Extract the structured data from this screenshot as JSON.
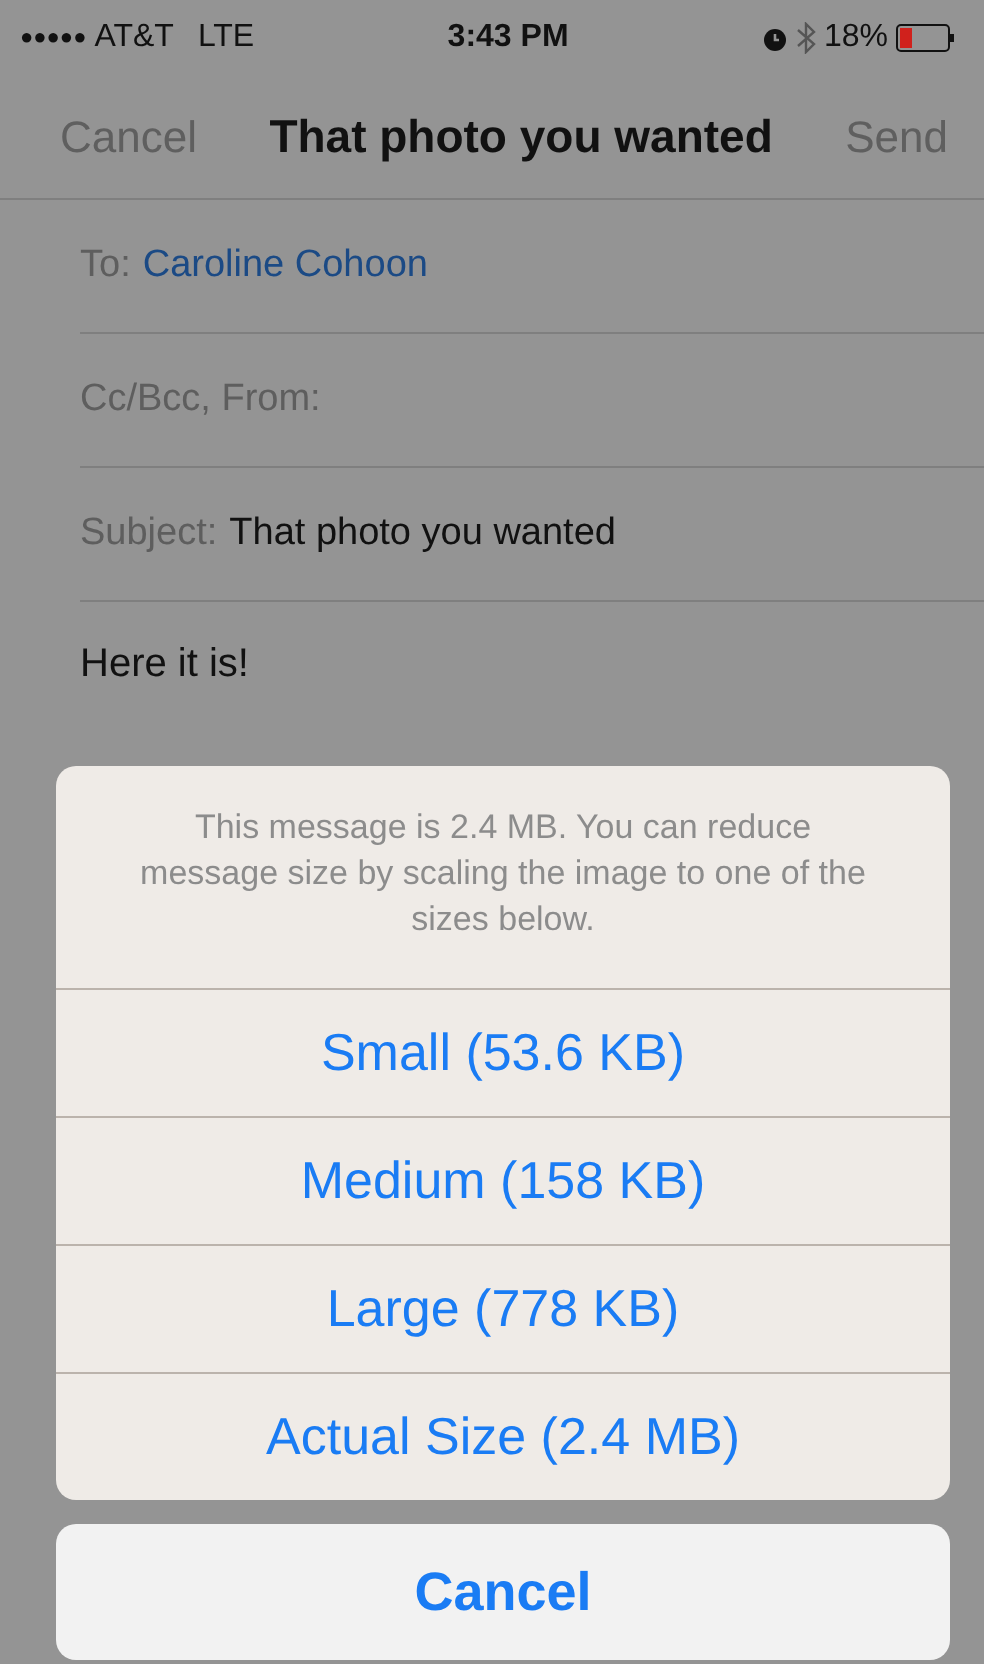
{
  "status_bar": {
    "signal": "●●●●●",
    "carrier": "AT&T",
    "network": "LTE",
    "time": "3:43 PM",
    "battery": "18%"
  },
  "nav_bar": {
    "left": "Cancel",
    "title": "That photo you wanted",
    "right": "Send"
  },
  "fields": [
    {
      "label": "To:",
      "recipients": [
        "Caroline Cohoon"
      ]
    },
    {
      "label": "Cc/Bcc, From:"
    },
    {
      "label": "Subject:",
      "value": "That photo you wanted"
    }
  ],
  "body": "Here it is!",
  "action_sheet": {
    "message": "This message is 2.4 MB. You can reduce message size by scaling the image to one of the sizes below.",
    "options": [
      "Small (53.6 KB)",
      "Medium (158 KB)",
      "Large (778 KB)",
      "Actual Size (2.4 MB)"
    ],
    "cancel": "Cancel"
  }
}
